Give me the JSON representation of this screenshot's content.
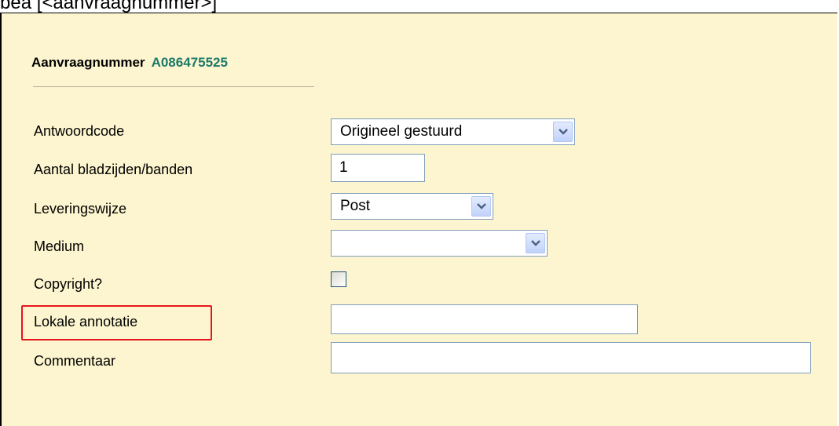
{
  "header": {
    "top_text": "bea [<aanvraagnummer>]",
    "request_label": "Aanvraagnummer",
    "request_number": "A086475525"
  },
  "form": {
    "antwoordcode": {
      "label": "Antwoordcode",
      "value": "Origineel gestuurd"
    },
    "aantal": {
      "label": "Aantal bladzijden/banden",
      "value": "1"
    },
    "leveringswijze": {
      "label": "Leveringswijze",
      "value": "Post"
    },
    "medium": {
      "label": "Medium",
      "value": ""
    },
    "copyright": {
      "label": "Copyright?",
      "checked": false
    },
    "lokale_annotatie": {
      "label": "Lokale annotatie",
      "value": ""
    },
    "commentaar": {
      "label": "Commentaar",
      "value": ""
    }
  },
  "colors": {
    "panel_background": "#fcf5cf",
    "request_number": "#1b7a6a",
    "highlight_border": "#e8141c",
    "input_border": "#7f9db9"
  },
  "icons": {
    "dropdown": "chevron-down-icon"
  }
}
